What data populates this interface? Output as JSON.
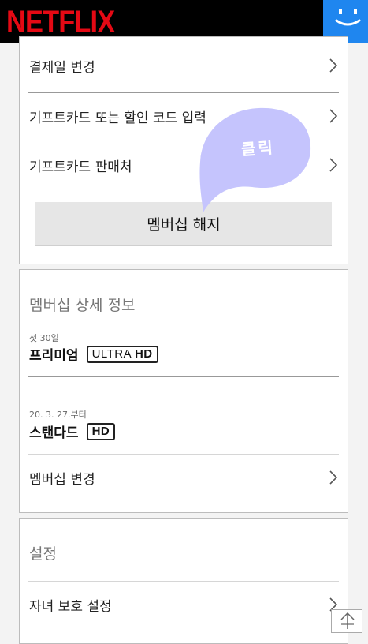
{
  "header": {
    "logo": "NETFLIX",
    "avatar_icon": "smiley-face-icon"
  },
  "billing": {
    "items": [
      {
        "label": "결제일 변경"
      },
      {
        "label": "기프트카드 또는 할인 코드 입력"
      },
      {
        "label": "기프트카드 판매처"
      }
    ],
    "cancel_button": "멤버십 해지"
  },
  "annotation": {
    "bubble_text": "클릭",
    "bubble_color": "#c5c4fd"
  },
  "membership": {
    "title": "멤버십 상세 정보",
    "current": {
      "note": "첫 30일",
      "plan": "프리미엄",
      "badge_light": "ULTRA ",
      "badge_bold": "HD"
    },
    "next": {
      "note": "20. 3. 27.부터",
      "plan": "스탠다드",
      "badge": "HD"
    },
    "change_label": "멤버십 변경"
  },
  "settings": {
    "title": "설정",
    "items": [
      {
        "label": "자녀 보호 설정"
      }
    ]
  },
  "colors": {
    "brand": "#e50914",
    "avatar": "#1f86ef"
  }
}
